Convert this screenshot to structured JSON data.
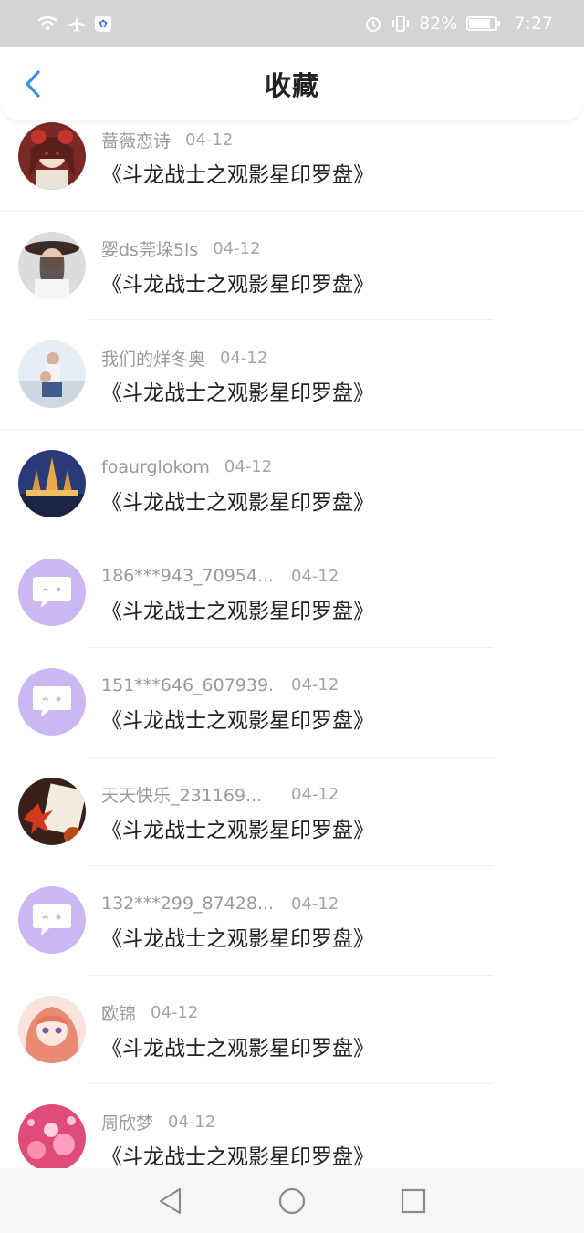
{
  "status_bar": {
    "battery": "82%",
    "battery_level": 0.82,
    "time": "7:27",
    "icons": [
      "wifi-icon",
      "airplane-icon",
      "baidu-paw-icon",
      "alarm-icon",
      "vibrate-icon",
      "battery-icon"
    ]
  },
  "header": {
    "title": "收藏",
    "back_icon": "chevron-left-icon",
    "accent_color": "#3d8ee8"
  },
  "items": [
    {
      "name": "蔷薇恋诗",
      "date": "04-12",
      "title": "《斗龙战士之观影星印罗盘》",
      "avatar": "anime-girl-red"
    },
    {
      "name": "婴ds莞垛5ls",
      "date": "04-12",
      "title": "《斗龙战士之观影星印罗盘》",
      "avatar": "woman-hat"
    },
    {
      "name": "我们的烊冬奥",
      "date": "04-12",
      "title": "《斗龙战士之观影星印罗盘》",
      "avatar": "father-child"
    },
    {
      "name": "foaurglokom",
      "date": "04-12",
      "title": "《斗龙战士之观影星印罗盘》",
      "avatar": "temple-night"
    },
    {
      "name": "186***943_70954...",
      "date": "04-12",
      "title": "《斗龙战士之观影星印罗盘》",
      "avatar": "default-chat"
    },
    {
      "name": "151***646_607939...",
      "date": "04-12",
      "title": "《斗龙战士之观影星印罗盘》",
      "avatar": "default-chat"
    },
    {
      "name": "天天快乐_231169...",
      "date": "04-12",
      "title": "《斗龙战士之观影星印罗盘》",
      "avatar": "autumn-leaf"
    },
    {
      "name": "132***299_87428...",
      "date": "04-12",
      "title": "《斗龙战士之观影星印罗盘》",
      "avatar": "default-chat"
    },
    {
      "name": "欧锦",
      "date": "04-12",
      "title": "《斗龙战士之观影星印罗盘》",
      "avatar": "anime-girl-pink"
    },
    {
      "name": "周欣梦",
      "date": "04-12",
      "title": "《斗龙战士之观影星印罗盘》",
      "avatar": "pink-flowers"
    }
  ],
  "nav": {
    "back": "triangle-back-icon",
    "home": "circle-home-icon",
    "recents": "square-recents-icon"
  }
}
